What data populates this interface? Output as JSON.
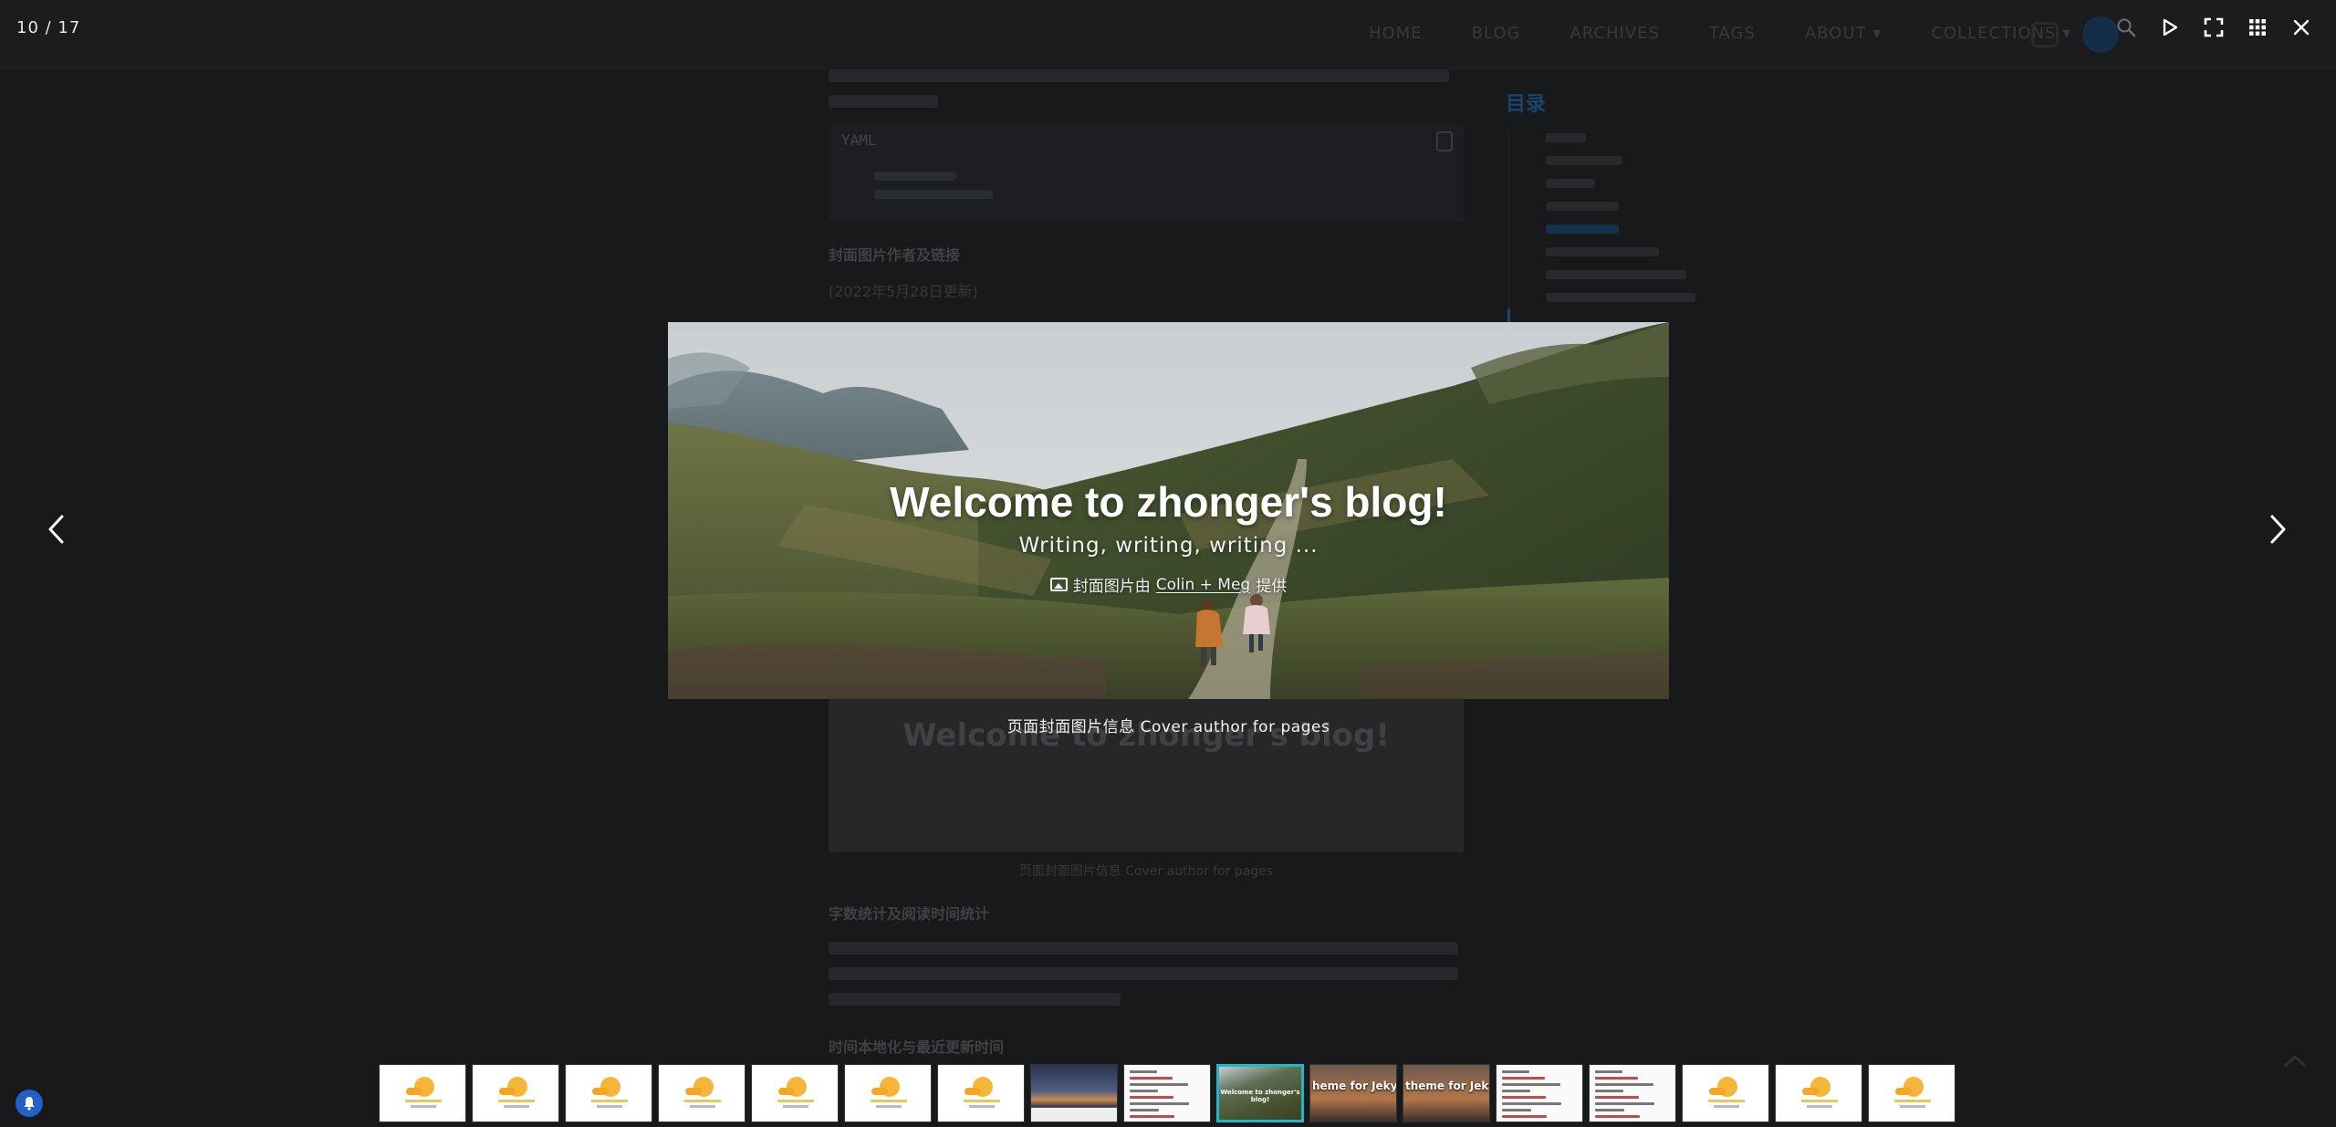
{
  "viewer": {
    "counter": "10 / 17",
    "slide": {
      "title": "Welcome to zhonger's blog!",
      "subtitle": "Writing, writing, writing ...",
      "credit_prefix": "封面图片由",
      "credit_link": "Colin + Meg",
      "credit_suffix": "提供",
      "caption": "页面封面图片信息 Cover author for pages"
    },
    "toolbar": {
      "icons": [
        "search-icon",
        "play-icon",
        "fullscreen-icon",
        "grid-icon",
        "close-icon"
      ]
    },
    "thumbnails": [
      {
        "kind": "loading"
      },
      {
        "kind": "loading"
      },
      {
        "kind": "loading"
      },
      {
        "kind": "loading"
      },
      {
        "kind": "loading"
      },
      {
        "kind": "loading"
      },
      {
        "kind": "loading"
      },
      {
        "kind": "landscape"
      },
      {
        "kind": "document"
      },
      {
        "kind": "active-cover"
      },
      {
        "kind": "banner",
        "text": "heme for Jekyll"
      },
      {
        "kind": "banner",
        "text": "theme for Jekyll"
      },
      {
        "kind": "document"
      },
      {
        "kind": "document"
      },
      {
        "kind": "loading"
      },
      {
        "kind": "loading"
      },
      {
        "kind": "loading"
      }
    ]
  },
  "background_page": {
    "nav": [
      "HOME",
      "BLOG",
      "ARCHIVES",
      "TAGS",
      "ABOUT ▾",
      "COLLECTIONS ▾"
    ],
    "toc_title": "目录",
    "code_lang": "YAML",
    "heading_1": "封面图片作者及链接",
    "date_note": "(2022年5月28日更新)",
    "figure_caption": "页面封面图片信息 Cover author for pages",
    "heading_2": "字数统计及阅读时间统计",
    "heading_3": "时间本地化与最近更新时间"
  },
  "colors": {
    "accent": "#1fb6c6",
    "notification": "#2460c9"
  }
}
